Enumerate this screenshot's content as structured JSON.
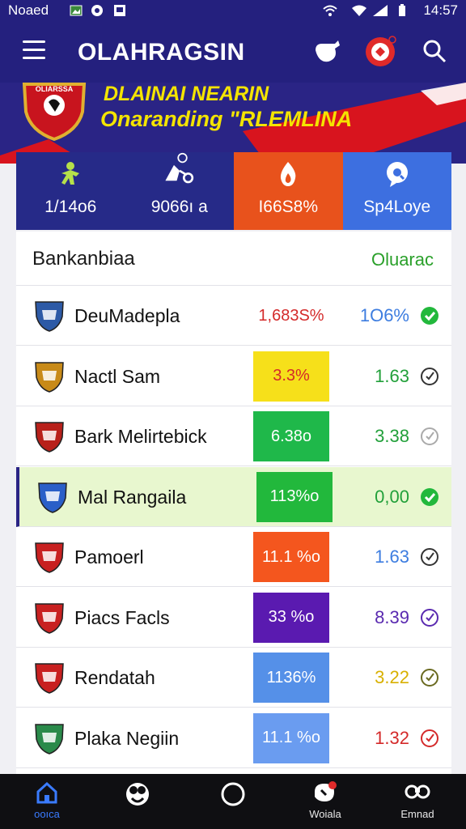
{
  "status_bar": {
    "carrier": "Noaed",
    "time": "14:57"
  },
  "app_bar": {
    "title": "OLAHRAGSIN"
  },
  "banner": {
    "badge_text": "OLIARSSA",
    "line1": "DLAINAI NEARIN",
    "line2": "Onaranding \"RLEMLINA"
  },
  "tiles": [
    {
      "label": "1/14o6",
      "color": "#262a88",
      "icon": "runner-icon"
    },
    {
      "label": "9066ı a",
      "color": "#262a88",
      "icon": "referee-icon"
    },
    {
      "label": "I66S8%",
      "color": "#e8521c",
      "icon": "flame-icon"
    },
    {
      "label": "Sp4Loye",
      "color": "#3d6fe0",
      "icon": "chat-icon"
    }
  ],
  "card": {
    "title": "Bankanbiaa",
    "link": "Oluarac"
  },
  "rows": [
    {
      "name": "DeuMadepla",
      "pct": "1,683S%",
      "pill_color": "",
      "pct_color": "#d42a2a",
      "value": "1O6%",
      "value_color": "#3d7de0",
      "check": "filled-green",
      "logo_color": "#2d5aa6"
    },
    {
      "name": "Nactl Sam",
      "pct": "3.3%",
      "pill_color": "#f6e01a",
      "pct_color": "#d42a2a",
      "value": "1.63",
      "value_color": "#22a03a",
      "check": "outline",
      "logo_color": "#c88a18"
    },
    {
      "name": "Bark Melirtebick",
      "pct": "6.38o",
      "pill_color": "#1fb84a",
      "pct_color": "#ffffff",
      "value": "3.38",
      "value_color": "#22a03a",
      "check": "outline-faint",
      "logo_color": "#b8201a"
    },
    {
      "name": "Mal Rangaila",
      "pct": "113%o",
      "pill_color": "#22b83c",
      "pct_color": "#ffffff",
      "value": "0,00",
      "value_color": "#22a03a",
      "check": "filled-green",
      "logo_color": "#2a5fc8"
    },
    {
      "name": "Pamoerl",
      "pct": "11.1 %o",
      "pill_color": "#f4561e",
      "pct_color": "#ffffff",
      "value": "1.63",
      "value_color": "#3d7de0",
      "check": "outline",
      "logo_color": "#c82020"
    },
    {
      "name": "Piacs Facls",
      "pct": "33 %o",
      "pill_color": "#5a1ab0",
      "pct_color": "#ffffff",
      "value": "8.39",
      "value_color": "#5a2ab0",
      "check": "outline-purple",
      "logo_color": "#c82020"
    },
    {
      "name": "Rendatah",
      "pct": "1136%",
      "pill_color": "#5590e8",
      "pct_color": "#ffffff",
      "value": "3.22",
      "value_color": "#d8b000",
      "check": "outline-olive",
      "logo_color": "#c82020"
    },
    {
      "name": "Plaka Negiin",
      "pct": "11.1 %o",
      "pill_color": "#6a9cf0",
      "pct_color": "#ffffff",
      "value": "1.32",
      "value_color": "#d42a2a",
      "check": "outline-red",
      "logo_color": "#2a8a4a"
    }
  ],
  "bottom_nav": [
    {
      "label": "ooıca",
      "icon": "home-icon",
      "active": true
    },
    {
      "label": "",
      "icon": "ball-icon",
      "active": false
    },
    {
      "label": "",
      "icon": "circle-icon",
      "active": false
    },
    {
      "label": "Woiala",
      "icon": "notification-icon",
      "active": false
    },
    {
      "label": "Emnad",
      "icon": "binoculars-icon",
      "active": false
    }
  ]
}
